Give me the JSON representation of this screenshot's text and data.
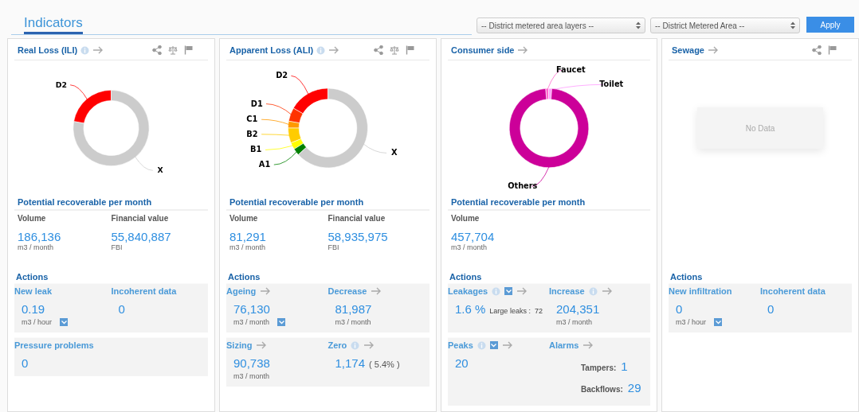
{
  "header": {
    "title": "Indicators",
    "selects": [
      {
        "placeholder": "-- District metered area layers --"
      },
      {
        "placeholder": "-- District Metered Area --"
      }
    ],
    "apply": "Apply"
  },
  "cards": [
    {
      "title": "Real Loss (ILI)",
      "info": true,
      "arrow": true,
      "tools": [
        {
          "kind": "share"
        },
        {
          "kind": "scale"
        },
        {
          "kind": "flag"
        }
      ],
      "chart": {
        "segments": [
          {
            "label": "D2",
            "color": "#ff0000"
          },
          {
            "label": "X",
            "color": "#cccccc"
          }
        ]
      },
      "recoverable": {
        "heading": "Potential recoverable per month",
        "metrics": [
          {
            "label": "Volume",
            "value": "186,136",
            "unit": "m3 / month"
          },
          {
            "label": "Financial value",
            "value": "55,840,887",
            "unit": "FBI"
          }
        ]
      },
      "actions": {
        "heading": "Actions",
        "groups": [
          {
            "items": [
              {
                "title": "New leak",
                "value": "0.19",
                "unit": "m3 / hour",
                "unit_dropdown": true
              },
              {
                "title": "Incoherent data",
                "value": "0"
              }
            ]
          },
          {
            "items": [
              {
                "title": "Pressure problems",
                "value": "0"
              }
            ]
          }
        ]
      }
    },
    {
      "title": "Apparent Loss (ALI)",
      "info": true,
      "arrow": true,
      "tools": [
        {
          "kind": "share"
        },
        {
          "kind": "scale"
        },
        {
          "kind": "flag"
        }
      ],
      "chart": {
        "segments": [
          {
            "label": "D2",
            "color": "#ff0000"
          },
          {
            "label": "D1",
            "color": "#ff3300"
          },
          {
            "label": "C1",
            "color": "#ff9900"
          },
          {
            "label": "B2",
            "color": "#ffcc00"
          },
          {
            "label": "B1",
            "color": "#ffff00"
          },
          {
            "label": "A1",
            "color": "#008000"
          },
          {
            "label": "X",
            "color": "#cccccc"
          }
        ]
      },
      "recoverable": {
        "heading": "Potential recoverable per month",
        "metrics": [
          {
            "label": "Volume",
            "value": "81,291",
            "unit": "m3 / month"
          },
          {
            "label": "Financial value",
            "value": "58,935,975",
            "unit": "FBI"
          }
        ]
      },
      "actions": {
        "heading": "Actions",
        "groups": [
          {
            "items": [
              {
                "title": "Ageing",
                "arrow": true,
                "value": "76,130",
                "unit": "m3 / month",
                "unit_dropdown": true
              },
              {
                "title": "Decrease",
                "arrow": true,
                "value": "81,987",
                "unit": "m3 / month"
              }
            ]
          },
          {
            "items": [
              {
                "title": "Sizing",
                "arrow": true,
                "value": "90,738",
                "unit": "m3 / month"
              },
              {
                "title": "Zero",
                "info": true,
                "arrow": true,
                "value": "1,174",
                "note": "( 5.4% )"
              }
            ]
          }
        ]
      }
    },
    {
      "title": "Consumer side",
      "arrow": true,
      "chart": {
        "segments": [
          {
            "label": "Faucet",
            "color": "#ff66cc"
          },
          {
            "label": "Toilet",
            "color": "#ff99ff"
          },
          {
            "label": "Others",
            "color": "#cc0099"
          }
        ]
      },
      "recoverable": {
        "heading": "Potential recoverable per month",
        "metrics": [
          {
            "label": "Volume",
            "value": "457,704",
            "unit": "m3 / month"
          }
        ]
      },
      "actions": {
        "heading": "Actions",
        "groups": [
          {
            "items": [
              {
                "title": "Leakages",
                "info": true,
                "title_dropdown": true,
                "arrow": true,
                "value": "1.6 %",
                "aside_label": "Large leaks :",
                "aside_value": "72"
              },
              {
                "title": "Increase",
                "info": true,
                "arrow": true,
                "value": "204,351",
                "unit": "m3 / month"
              }
            ]
          },
          {
            "items": [
              {
                "title": "Peaks",
                "info": true,
                "title_dropdown": true,
                "arrow": true,
                "value": "20"
              },
              {
                "title": "Alarms",
                "arrow": true,
                "counts": [
                  {
                    "label": "Tampers:",
                    "value": "1"
                  },
                  {
                    "label": "Backflows:",
                    "value": "29"
                  }
                ]
              }
            ]
          }
        ]
      }
    },
    {
      "title": "Sewage",
      "arrow": true,
      "tools": [
        {
          "kind": "share"
        },
        {
          "kind": "flag"
        }
      ],
      "no_data": "No Data",
      "actions": {
        "heading": "Actions",
        "groups": [
          {
            "items": [
              {
                "title": "New infiltration",
                "value": "0",
                "unit": "m3 / hour",
                "unit_dropdown": true
              },
              {
                "title": "Incoherent data",
                "value": "0"
              }
            ]
          }
        ]
      }
    }
  ]
}
